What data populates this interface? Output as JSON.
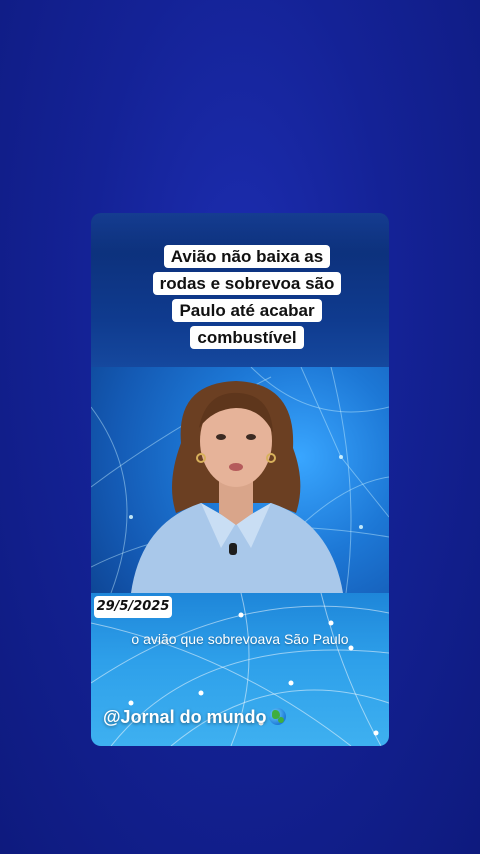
{
  "headline": {
    "lines": [
      "Avião não baixa as",
      "rodas e sobrevoa são",
      "Paulo até acabar",
      "combustível"
    ]
  },
  "date": "29/5/2025",
  "caption": "o avião que sobrevoava São Paulo",
  "handle": "@Jornal do mundo",
  "icons": {
    "handle_suffix": "globe-icon"
  },
  "colors": {
    "background": "#142296",
    "caption_box": "#ffffff",
    "video_blue": "#1d78d6"
  }
}
